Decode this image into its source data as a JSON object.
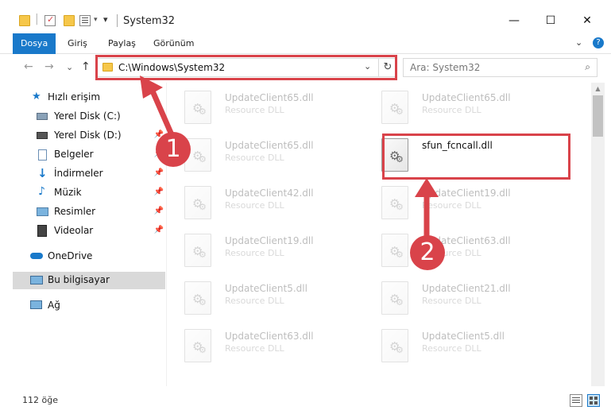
{
  "window": {
    "title": "System32",
    "minimize": "—",
    "maximize": "☐",
    "close": "✕"
  },
  "ribbon": {
    "tabs": [
      "Dosya",
      "Giriş",
      "Paylaş",
      "Görünüm"
    ],
    "expand": "⌄",
    "help": "?"
  },
  "nav": {
    "back": "←",
    "forward": "→",
    "recent": "⌄",
    "up": "↑",
    "address": "C:\\Windows\\System32",
    "address_dropdown": "⌄",
    "refresh": "↻",
    "search_placeholder": "Ara: System32",
    "search_glyph": "⌕"
  },
  "sidebar": {
    "items": [
      {
        "label": "Hızlı erişim",
        "icon": "star-icon",
        "pinned": false
      },
      {
        "label": "Yerel Disk (C:)",
        "icon": "drive-icon",
        "pinned": false
      },
      {
        "label": "Yerel Disk (D:)",
        "icon": "drive-icon",
        "pinned": true
      },
      {
        "label": "Belgeler",
        "icon": "documents-icon",
        "pinned": true
      },
      {
        "label": "İndirmeler",
        "icon": "download-icon",
        "pinned": true
      },
      {
        "label": "Müzik",
        "icon": "music-icon",
        "pinned": true
      },
      {
        "label": "Resimler",
        "icon": "pictures-icon",
        "pinned": true
      },
      {
        "label": "Videolar",
        "icon": "videos-icon",
        "pinned": true
      },
      {
        "label": "OneDrive",
        "icon": "cloud-icon",
        "pinned": false
      },
      {
        "label": "Bu bilgisayar",
        "icon": "computer-icon",
        "pinned": false,
        "selected": true
      },
      {
        "label": "Ağ",
        "icon": "network-icon",
        "pinned": false
      }
    ]
  },
  "files": [
    {
      "name": "UpdateClient65.dll",
      "type": "Resource DLL"
    },
    {
      "name": "UpdateClient65.dll",
      "type": "Resource DLL"
    },
    {
      "name": "UpdateClient65.dll",
      "type": "Resource DLL"
    },
    {
      "name": "sfun_fcncall.dll",
      "type": ""
    },
    {
      "name": "UpdateClient42.dll",
      "type": "Resource DLL"
    },
    {
      "name": "UpdateClient19.dll",
      "type": "Resource DLL"
    },
    {
      "name": "UpdateClient19.dll",
      "type": "Resource DLL"
    },
    {
      "name": "UpdateClient63.dll",
      "type": "Resource DLL"
    },
    {
      "name": "UpdateClient5.dll",
      "type": "Resource DLL"
    },
    {
      "name": "UpdateClient21.dll",
      "type": "Resource DLL"
    },
    {
      "name": "UpdateClient63.dll",
      "type": "Resource DLL"
    },
    {
      "name": "UpdateClient5.dll",
      "type": "Resource DLL"
    }
  ],
  "status": {
    "item_count": "112 öğe"
  },
  "annotations": {
    "step1": "1",
    "step2": "2"
  },
  "colors": {
    "accent": "#1979ca",
    "highlight": "#d9434a",
    "folder": "#f6c74a"
  }
}
